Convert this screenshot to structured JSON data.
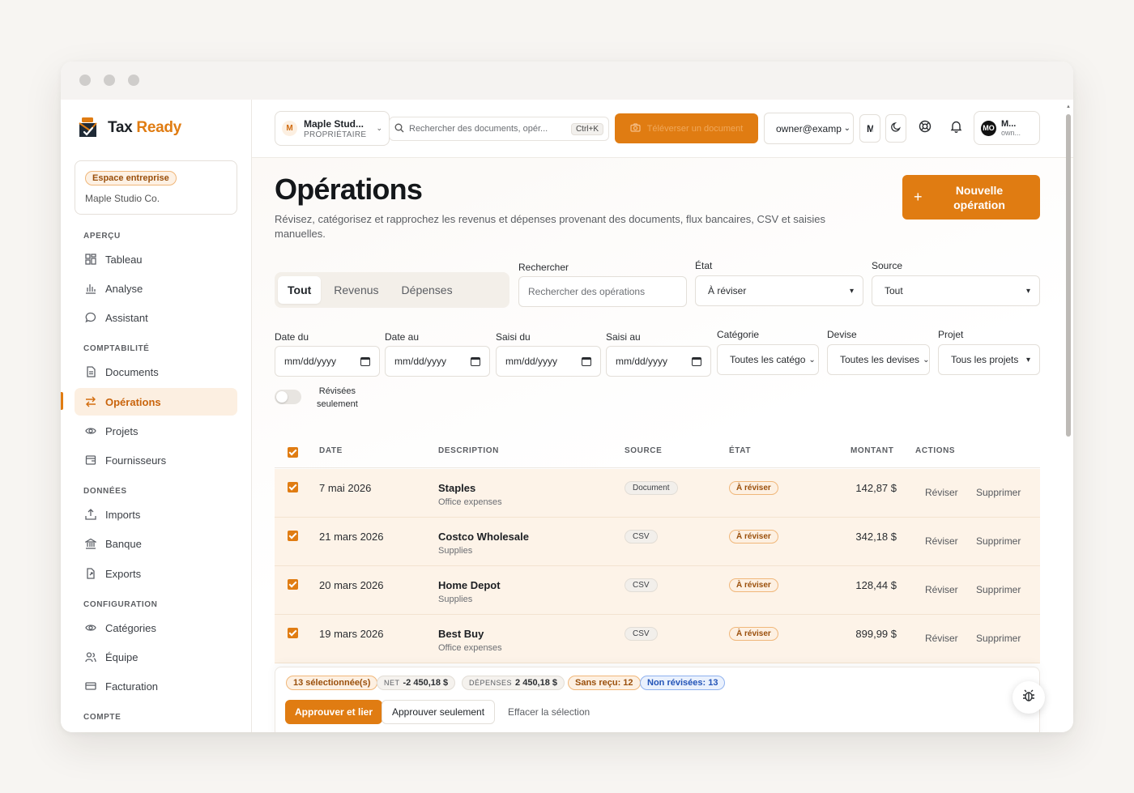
{
  "app": {
    "logo_part1": "Tax ",
    "logo_part2": "Ready",
    "accent_color": "#e07c12"
  },
  "sidebar": {
    "workspace_badge": "Espace entreprise",
    "workspace_name": "Maple Studio Co.",
    "sections": {
      "apercu": "APERÇU",
      "comptabilite": "COMPTABILITÉ",
      "donnees": "DONNÉES",
      "configuration": "CONFIGURATION",
      "compte": "COMPTE"
    },
    "items": [
      {
        "label": "Tableau",
        "icon": "dashboard-icon"
      },
      {
        "label": "Analyse",
        "icon": "bar-chart-icon"
      },
      {
        "label": "Assistant",
        "icon": "chat-bubble-icon"
      },
      {
        "label": "Documents",
        "icon": "document-icon"
      },
      {
        "label": "Opérations",
        "icon": "arrows-swap-icon",
        "active": true
      },
      {
        "label": "Projets",
        "icon": "eye-icon"
      },
      {
        "label": "Fournisseurs",
        "icon": "vendor-icon"
      },
      {
        "label": "Imports",
        "icon": "upload-icon"
      },
      {
        "label": "Banque",
        "icon": "bank-icon"
      },
      {
        "label": "Exports",
        "icon": "export-icon"
      },
      {
        "label": "Catégories",
        "icon": "eye-icon"
      },
      {
        "label": "Équipe",
        "icon": "team-icon"
      },
      {
        "label": "Facturation",
        "icon": "card-icon"
      }
    ]
  },
  "topbar": {
    "org_avatar": "M",
    "org_name": "Maple Stud...",
    "org_role": "PROPRIÉTAIRE",
    "search_placeholder": "Rechercher des documents, opér...",
    "search_shortcut": "Ctrl+K",
    "upload_label": "Téléverser un document",
    "email": "owner@examp",
    "lang_initial": "M",
    "user_avatar": "MO",
    "user_name": "M...",
    "user_sub": "own..."
  },
  "page": {
    "title": "Opérations",
    "description": "Révisez, catégorisez et rapprochez les revenus et dépenses provenant des documents, flux bancaires, CSV et saisies manuelles.",
    "new_button": "Nouvelle opération"
  },
  "tabs": [
    "Tout",
    "Revenus",
    "Dépenses"
  ],
  "filters": {
    "search_label": "Rechercher",
    "search_placeholder": "Rechercher des opérations",
    "state_label": "État",
    "state_value": "À réviser",
    "source_label": "Source",
    "source_value": "Tout",
    "date_from_label": "Date du",
    "date_to_label": "Date au",
    "entered_from_label": "Saisi du",
    "entered_to_label": "Saisi au",
    "date_placeholder": "mm/dd/yyyy",
    "category_label": "Catégorie",
    "category_value": "Toutes les catégo",
    "currency_label": "Devise",
    "currency_value": "Toutes les devises",
    "project_label": "Projet",
    "project_value": "Tous les projets",
    "reviewed_only_line1": "Révisées",
    "reviewed_only_line2": "seulement"
  },
  "table": {
    "headers": {
      "date": "DATE",
      "description": "DESCRIPTION",
      "source": "SOURCE",
      "state": "ÉTAT",
      "amount": "MONTANT",
      "actions": "ACTIONS"
    },
    "rows": [
      {
        "date": "7 mai 2026",
        "vendor": "Staples",
        "category": "Office expenses",
        "source": "Document",
        "state": "À réviser",
        "amount": "142,87 $"
      },
      {
        "date": "21 mars 2026",
        "vendor": "Costco Wholesale",
        "category": "Supplies",
        "source": "CSV",
        "state": "À réviser",
        "amount": "342,18 $"
      },
      {
        "date": "20 mars 2026",
        "vendor": "Home Depot",
        "category": "Supplies",
        "source": "CSV",
        "state": "À réviser",
        "amount": "128,44 $"
      },
      {
        "date": "19 mars 2026",
        "vendor": "Best Buy",
        "category": "Office expenses",
        "source": "CSV",
        "state": "À réviser",
        "amount": "899,99 $"
      }
    ],
    "review_action": "Réviser",
    "delete_action": "Supprimer"
  },
  "selection": {
    "selected": "13 sélectionnée(s)",
    "net_label": "NET",
    "net_value": "-2 450,18 $",
    "expenses_label": "DÉPENSES",
    "expenses_value": "2 450,18 $",
    "no_receipt": "Sans reçu: 12",
    "unreviewed": "Non révisées: 13",
    "approve_link": "Approuver et lier",
    "approve_only": "Approuver seulement",
    "clear": "Effacer la sélection"
  }
}
